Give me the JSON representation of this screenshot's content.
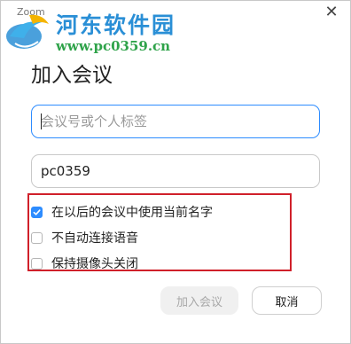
{
  "window": {
    "app_name": "Zoom",
    "close_glyph": "✕"
  },
  "watermark": {
    "title": "河东软件园",
    "url": "www.pc0359.cn"
  },
  "dialog": {
    "title": "加入会议",
    "meeting_id": {
      "placeholder": "会议号或个人标签",
      "value": ""
    },
    "name": {
      "value": "pc0359"
    },
    "options": [
      {
        "label": "在以后的会议中使用当前名字",
        "checked": true
      },
      {
        "label": "不自动连接语音",
        "checked": false
      },
      {
        "label": "保持摄像头关闭",
        "checked": false
      }
    ],
    "buttons": {
      "join": "加入会议",
      "cancel": "取消"
    }
  },
  "colors": {
    "accent": "#2d8cff",
    "highlight_border": "#d0202a",
    "disabled_text": "#a8a8a8"
  }
}
